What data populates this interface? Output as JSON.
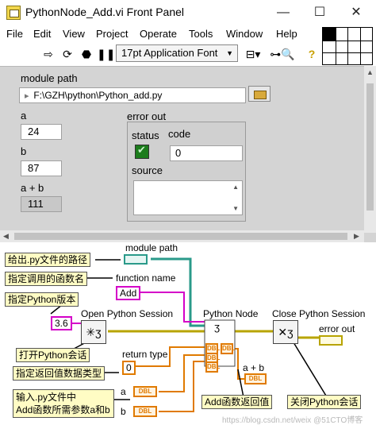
{
  "window": {
    "title": "PythonNode_Add.vi Front Panel",
    "minimize": "—",
    "maximize": "☐",
    "close": "✕"
  },
  "menu": [
    "File",
    "Edit",
    "View",
    "Project",
    "Operate",
    "Tools",
    "Window",
    "Help"
  ],
  "toolbar": {
    "font": "17pt Application Font",
    "icons": [
      "run-arrow-icon",
      "run-continuous-icon",
      "abort-icon",
      "pause-icon",
      "align-icon",
      "zoom-icon",
      "help-icon"
    ]
  },
  "panel": {
    "module_path_label": "module path",
    "module_path_value": "F:\\GZH\\python\\Python_add.py",
    "a_label": "a",
    "a_value": "24",
    "b_label": "b",
    "b_value": "87",
    "sum_label": "a + b",
    "sum_value": "111",
    "error_out_label": "error out",
    "status_label": "status",
    "code_label": "code",
    "code_value": "0",
    "source_label": "source"
  },
  "diagram": {
    "module_path_label": "module path",
    "function_name_label": "function name",
    "function_name_value": "Add",
    "version_value": "3.6",
    "open_session_label": "Open Python Session",
    "python_node_label": "Python Node",
    "close_session_label": "Close Python Session",
    "error_out_label": "error out",
    "return_type_label": "return type",
    "return_type_value": "0",
    "sum_label": "a + b",
    "a_label": "a",
    "b_label": "b",
    "dbl": "DBL",
    "notes": {
      "give_path": "给出.py文件的路径",
      "func_name": "指定调用的函数名",
      "version": "指定Python版本",
      "open": "打开Python会话",
      "return_type": "指定返回值数据类型",
      "input_line1": "输入.py文件中",
      "input_line2": "Add函数所需参数a和b",
      "add_return": "Add函数返回值",
      "close": "关闭Python会话"
    },
    "watermark": "https://blog.csdn.net/weix @51CTO博客"
  },
  "colors": {
    "path_wire": "#2a9a8a",
    "string_wire": "#d400c8",
    "numeric_wire": "#e07a00",
    "error_wire": "#b8a400",
    "led_on": "#1c7c1c"
  }
}
